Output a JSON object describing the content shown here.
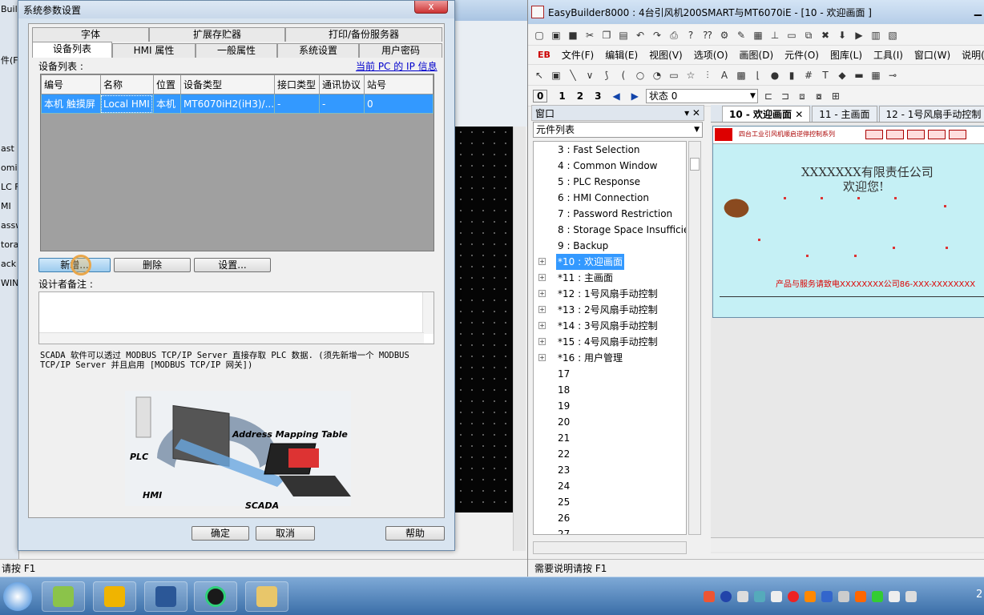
{
  "left_window": {
    "title": "Build",
    "sidebar_fragments": [
      "件(F)",
      "ast",
      "omi",
      "LC F",
      "MI",
      "assw",
      "tora",
      "ack",
      "WIN"
    ],
    "status": "请按 F1"
  },
  "dialog": {
    "title": "系统参数设置",
    "close": "x",
    "tabs_row1": [
      "字体",
      "扩展存贮器",
      "打印/备份服务器"
    ],
    "tabs_row2": [
      "设备列表",
      "HMI 属性",
      "一般属性",
      "系统设置",
      "用户密码"
    ],
    "device_list_label": "设备列表 :",
    "ip_link": "当前 PC 的 IP 信息",
    "columns": [
      "编号",
      "名称",
      "位置",
      "设备类型",
      "接口类型",
      "通讯协议",
      "站号"
    ],
    "rows": [
      [
        "本机 触摸屏",
        "Local HMI",
        "本机",
        "MT6070iH2(iH3)/...",
        "-",
        "-",
        "0"
      ]
    ],
    "buttons": {
      "new": "新增...",
      "delete": "删除",
      "settings": "设置..."
    },
    "designer_note_label": "设计者备注 :",
    "scada_text": "SCADA 软件可以透过 MODBUS TCP/IP Server 直接存取 PLC 数据. (须先新增一个 MODBUS TCP/IP Server 并且启用 [MODBUS TCP/IP 网关])",
    "diagram": {
      "address_mapping": "Address Mapping Table",
      "plc": "PLC",
      "hmi": "HMI",
      "scada": "SCADA"
    },
    "footer": {
      "ok": "确定",
      "cancel": "取消",
      "help": "帮助"
    }
  },
  "eb_window": {
    "title": "EasyBuilder8000 : 4台引风机200SMART与MT6070iE - [10 - 欢迎画面 ]",
    "menu_logo": "EB",
    "menu": [
      "文件(F)",
      "编辑(E)",
      "视图(V)",
      "选项(O)",
      "画图(D)",
      "元件(O)",
      "图库(L)",
      "工具(I)",
      "窗口(W)",
      "说明(H)"
    ],
    "layer_numbers": [
      "0",
      "1",
      "2",
      "3"
    ],
    "state_select": "状态 0",
    "panel_title": "窗口",
    "panel_select": "元件列表",
    "tree": [
      {
        "label": "3 : Fast Selection",
        "expand": false,
        "selected": false
      },
      {
        "label": "4 : Common Window",
        "expand": false,
        "selected": false
      },
      {
        "label": "5 : PLC Response",
        "expand": false,
        "selected": false
      },
      {
        "label": "6 : HMI Connection",
        "expand": false,
        "selected": false
      },
      {
        "label": "7 : Password Restriction",
        "expand": false,
        "selected": false
      },
      {
        "label": "8 : Storage Space Insufficien",
        "expand": false,
        "selected": false
      },
      {
        "label": "9 : Backup",
        "expand": false,
        "selected": false
      },
      {
        "label": "*10 : 欢迎画面",
        "expand": true,
        "selected": true
      },
      {
        "label": "*11 : 主画面",
        "expand": true,
        "selected": false
      },
      {
        "label": "*12 : 1号风扇手动控制",
        "expand": true,
        "selected": false
      },
      {
        "label": "*13 : 2号风扇手动控制",
        "expand": true,
        "selected": false
      },
      {
        "label": "*14 : 3号风扇手动控制",
        "expand": true,
        "selected": false
      },
      {
        "label": "*15 : 4号风扇手动控制",
        "expand": true,
        "selected": false
      },
      {
        "label": "*16 : 用户管理",
        "expand": true,
        "selected": false
      },
      {
        "label": "17",
        "expand": false,
        "selected": false
      },
      {
        "label": "18",
        "expand": false,
        "selected": false
      },
      {
        "label": "19",
        "expand": false,
        "selected": false
      },
      {
        "label": "20",
        "expand": false,
        "selected": false
      },
      {
        "label": "21",
        "expand": false,
        "selected": false
      },
      {
        "label": "22",
        "expand": false,
        "selected": false
      },
      {
        "label": "23",
        "expand": false,
        "selected": false
      },
      {
        "label": "24",
        "expand": false,
        "selected": false
      },
      {
        "label": "25",
        "expand": false,
        "selected": false
      },
      {
        "label": "26",
        "expand": false,
        "selected": false
      },
      {
        "label": "27",
        "expand": false,
        "selected": false
      }
    ],
    "doc_tabs": [
      "10 - 欢迎画面",
      "11 - 主画面",
      "12 - 1号风扇手动控制"
    ],
    "canvas": {
      "subtitle": "四台工业引风机顺启逆停控制系列",
      "company": "XXXXXXX有限责任公司",
      "welcome": "欢迎您!",
      "footer": "产品与服务请致电XXXXXXXX公司86-XXX-XXXXXXXX"
    },
    "status": "需要说明请按 F1"
  },
  "taskbar": {
    "clock": "2"
  }
}
